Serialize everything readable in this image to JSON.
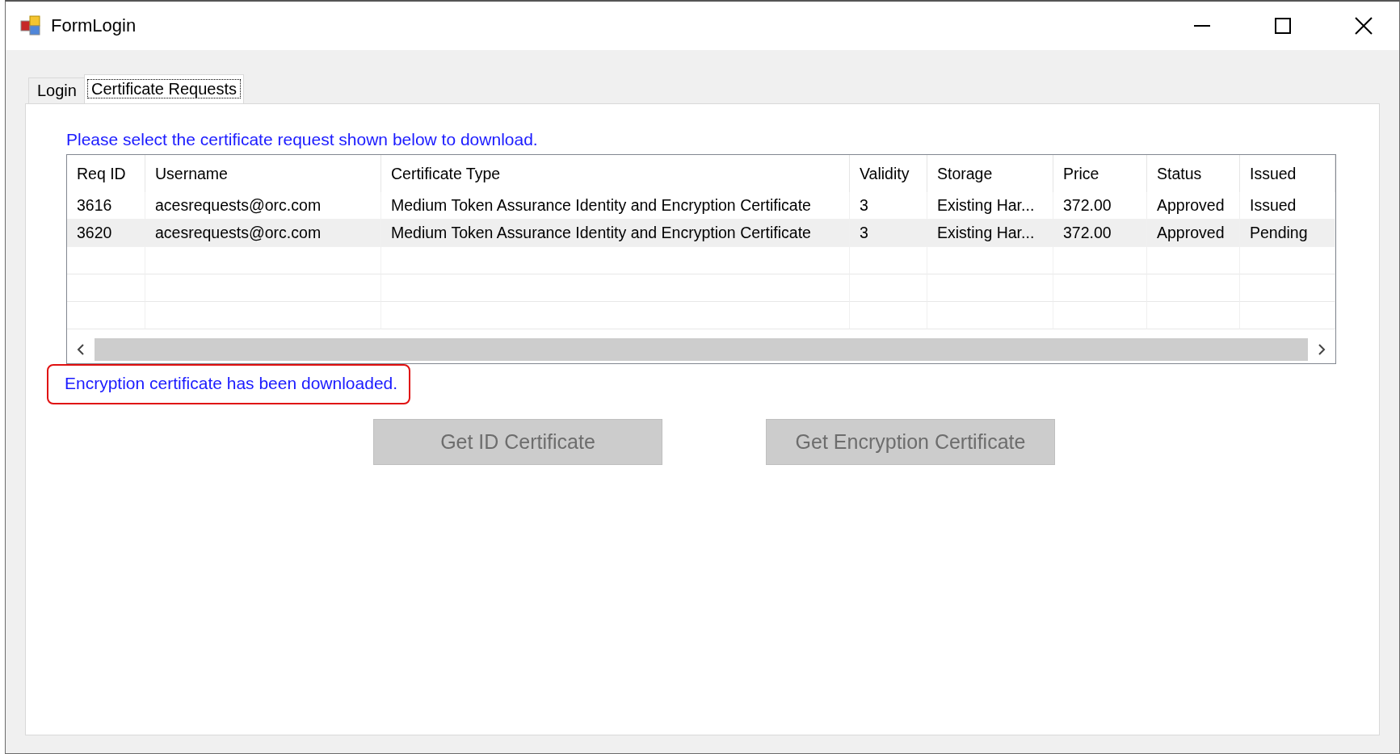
{
  "window": {
    "title": "FormLogin"
  },
  "tabs": [
    {
      "label": "Login",
      "selected": false
    },
    {
      "label": "Certificate Requests",
      "selected": true
    }
  ],
  "instruction": "Please select the certificate request shown below to download.",
  "table": {
    "columns": [
      "Req ID",
      "Username",
      "Certificate Type",
      "Validity",
      "Storage",
      "Price",
      "Status",
      "Issued"
    ],
    "rows": [
      {
        "cells": [
          "3616",
          "acesrequests@orc.com",
          "Medium Token Assurance Identity and Encryption Certificate",
          "3",
          "Existing Har...",
          "372.00",
          "Approved",
          "Issued"
        ],
        "selected": false
      },
      {
        "cells": [
          "3620",
          "acesrequests@orc.com",
          "Medium Token Assurance Identity and Encryption Certificate",
          "3",
          "Existing Har...",
          "372.00",
          "Approved",
          "Pending"
        ],
        "selected": true
      }
    ]
  },
  "status_message": "Encryption certificate has been downloaded.",
  "buttons": [
    {
      "label": "Get ID Certificate",
      "disabled": true
    },
    {
      "label": "Get Encryption Certificate",
      "disabled": true
    }
  ]
}
